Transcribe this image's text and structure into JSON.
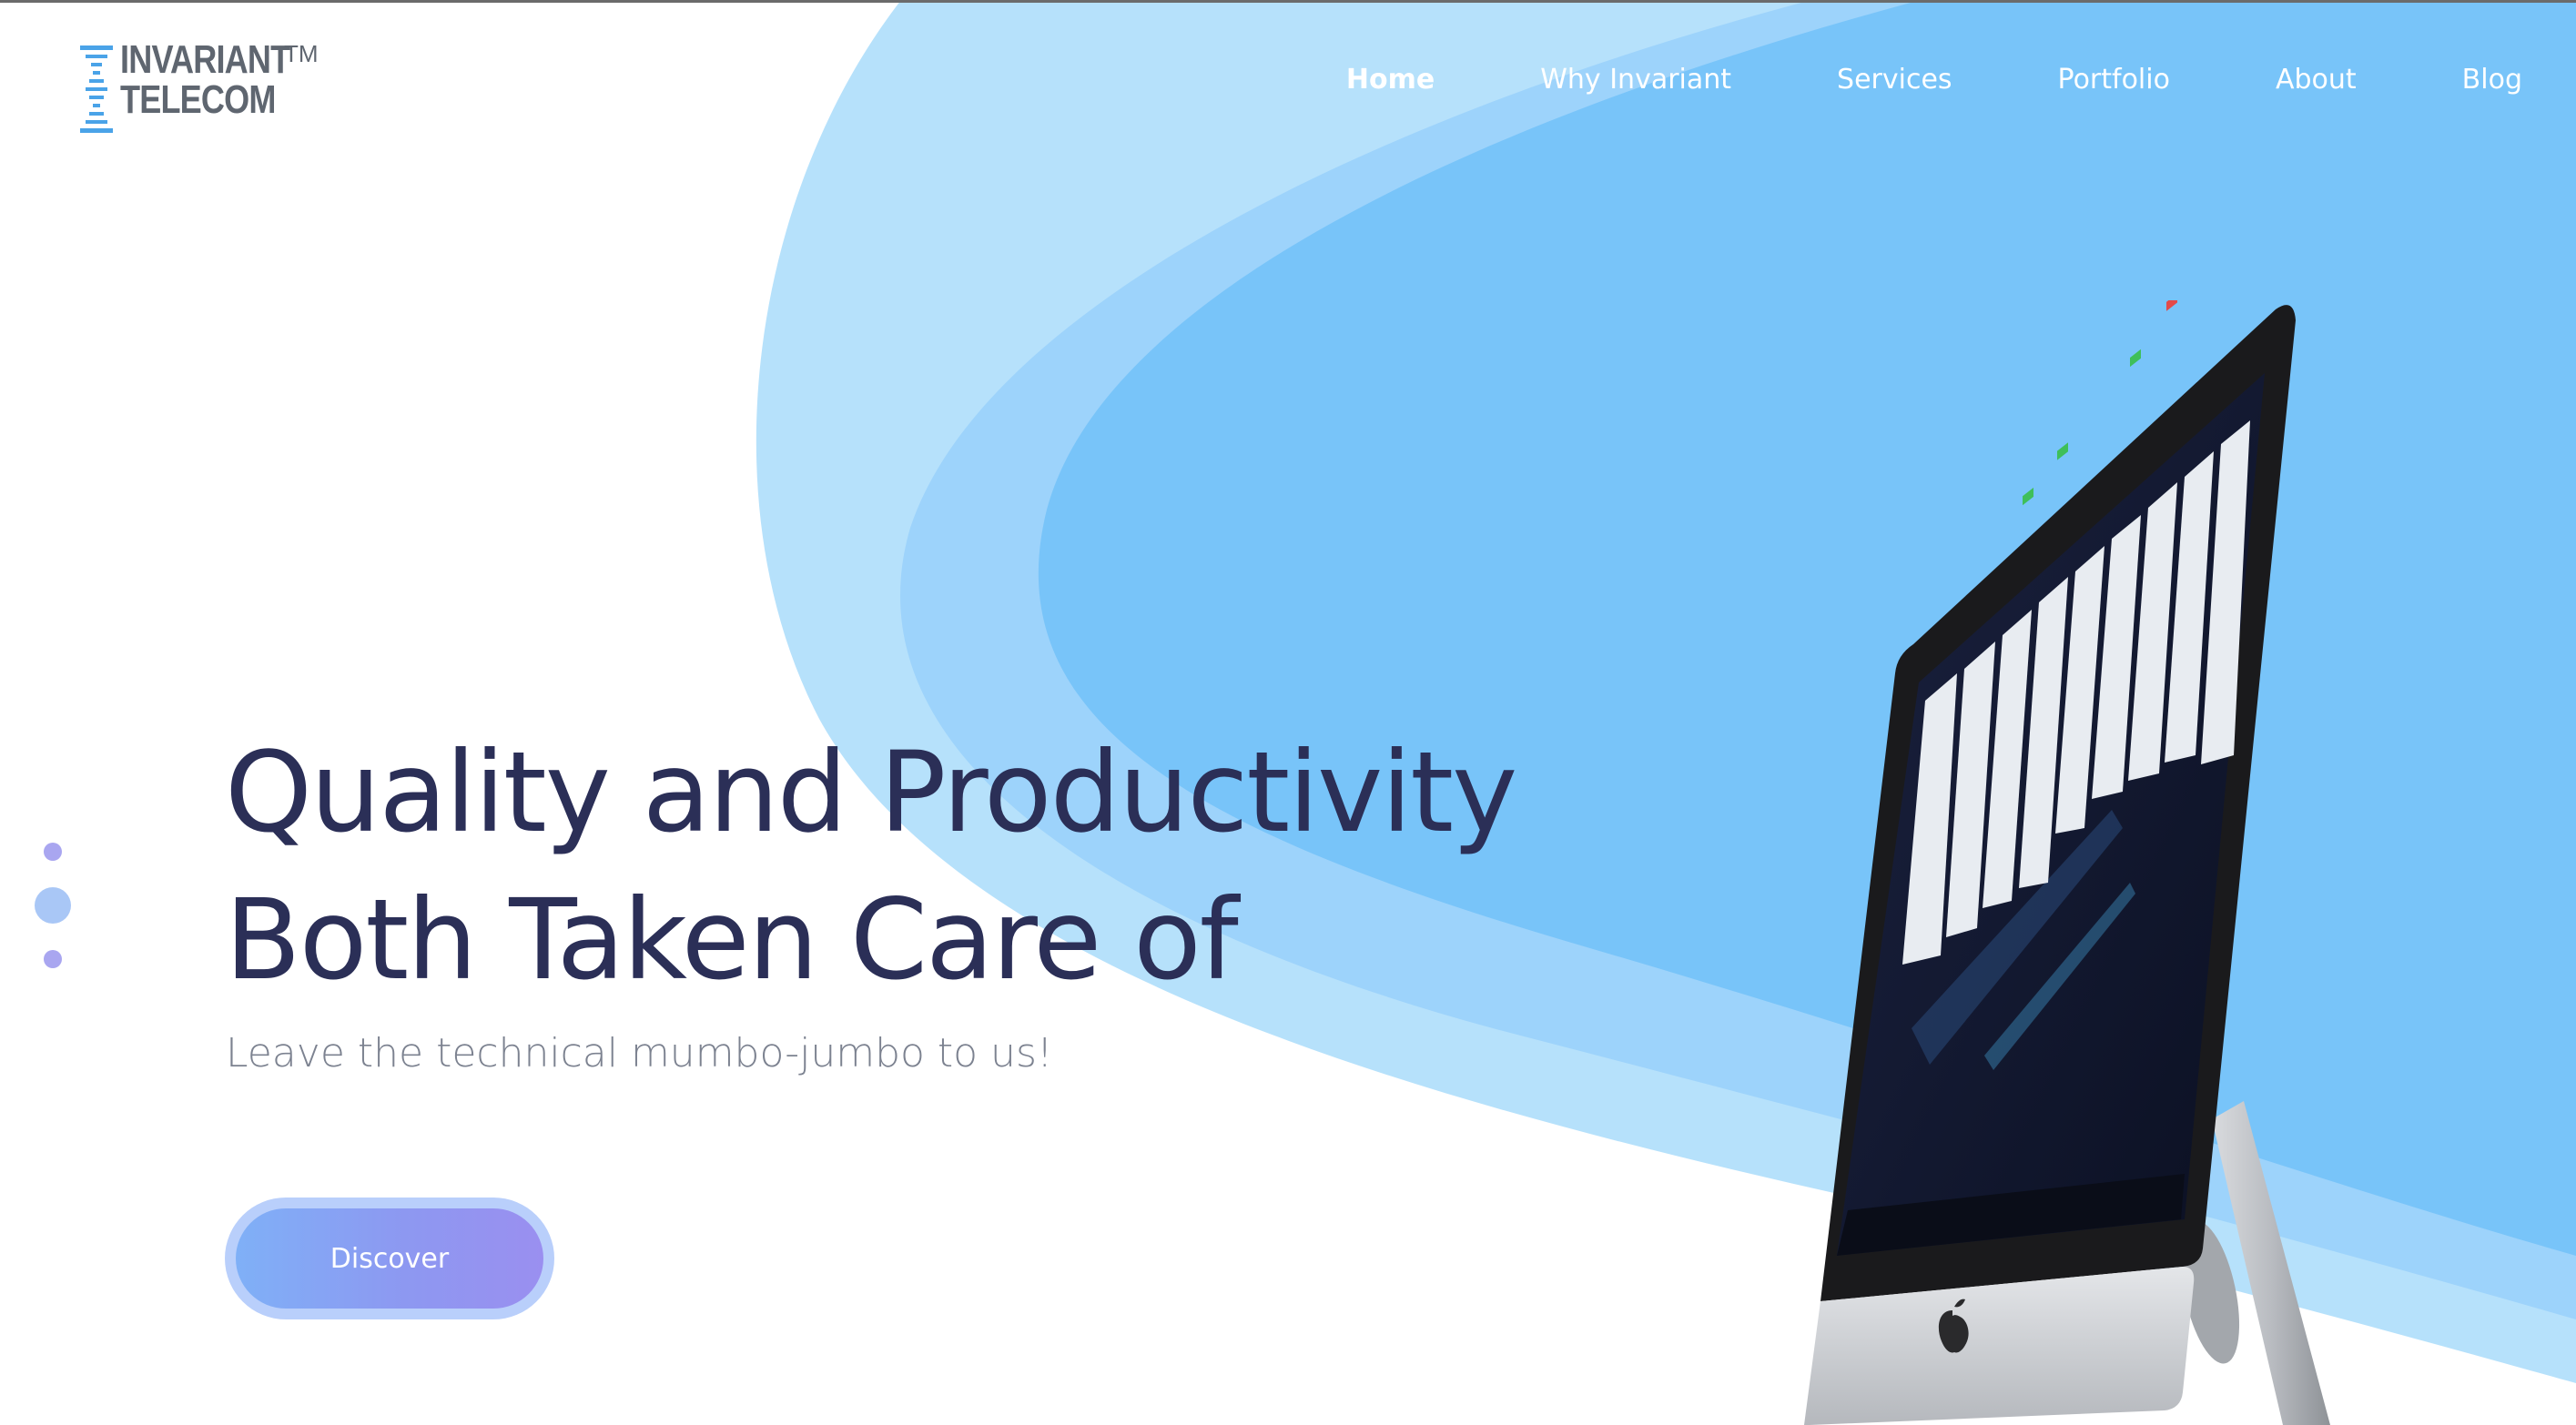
{
  "brand": {
    "line1": "INVARIANT",
    "line2": "TELECOM",
    "trademark": "TM",
    "logo_icon": "dna-ladder-icon"
  },
  "nav": {
    "items": [
      {
        "label": "Home",
        "active": true
      },
      {
        "label": "Why Invariant",
        "active": false
      },
      {
        "label": "Services",
        "active": false
      },
      {
        "label": "Portfolio",
        "active": false
      },
      {
        "label": "About",
        "active": false
      },
      {
        "label": "Blog",
        "active": false
      }
    ]
  },
  "hero": {
    "title_line1": "Quality and Productivity",
    "title_line2": "Both Taken Care of",
    "subtitle": "Leave the technical mumbo-jumbo to us!",
    "cta_label": "Discover"
  },
  "slider": {
    "dot_count": 3,
    "active_index": 1
  },
  "colors": {
    "title": "#2b2f57",
    "subtitle": "#7c8290",
    "blue_light": "#b6e1fb",
    "blue_mid": "#9dd3fb",
    "blue_deep": "#78c4f9",
    "nav_text": "#ffffff",
    "logo_gray": "#5f6670",
    "logo_blue": "#4aa3e8"
  },
  "illustration": "imac-with-kanban-board"
}
